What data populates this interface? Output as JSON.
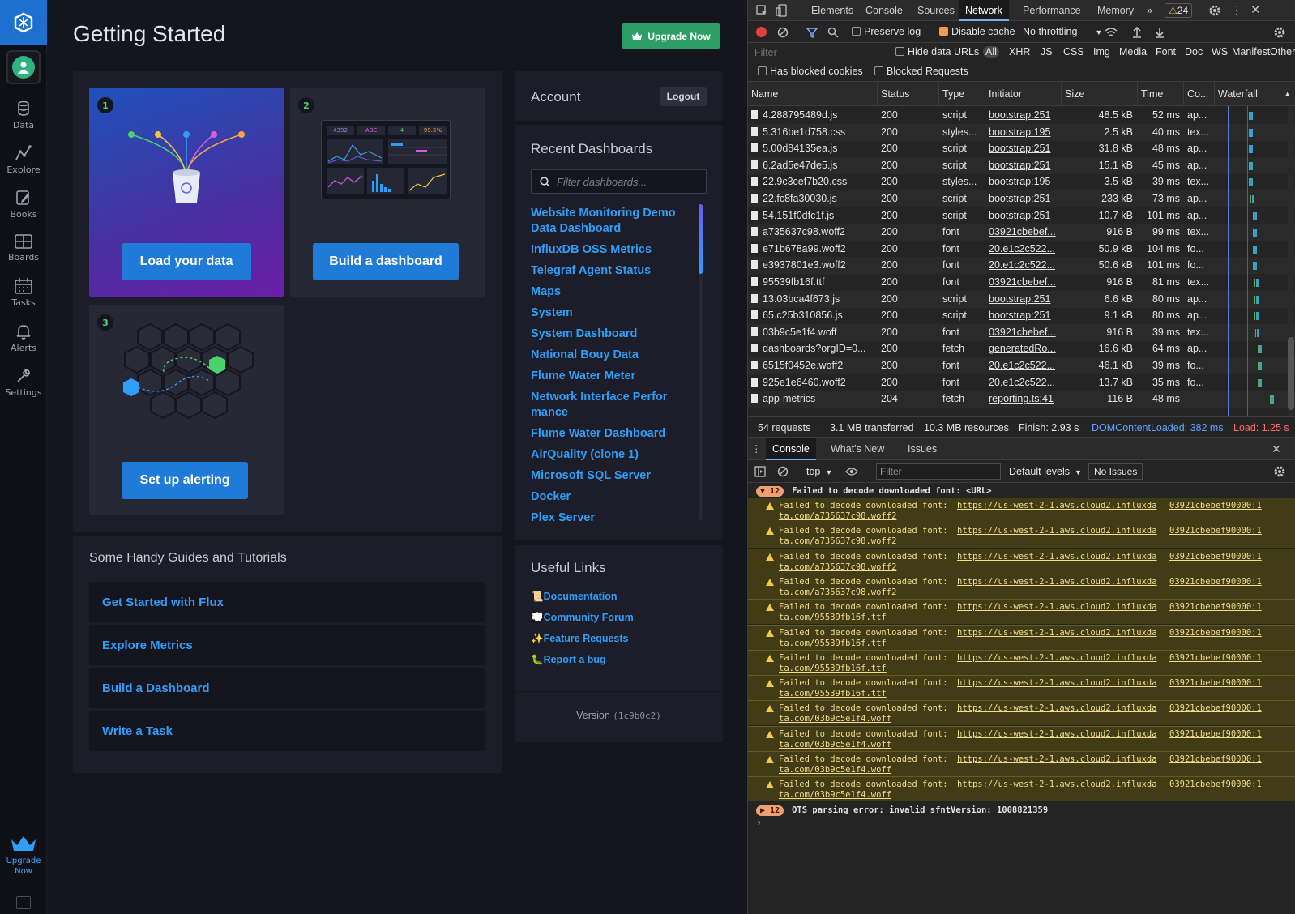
{
  "app": {
    "nav": {
      "items": [
        {
          "label": "Data",
          "icon": "database-icon"
        },
        {
          "label": "Explore",
          "icon": "graph-icon"
        },
        {
          "label": "Books",
          "icon": "notebook-icon"
        },
        {
          "label": "Boards",
          "icon": "dashboard-grid-icon"
        },
        {
          "label": "Tasks",
          "icon": "calendar-icon"
        },
        {
          "label": "Alerts",
          "icon": "bell-icon"
        },
        {
          "label": "Settings",
          "icon": "wrench-icon"
        }
      ],
      "upgrade_line1": "Upgrade",
      "upgrade_line2": "Now"
    },
    "page_title": "Getting Started",
    "upgrade_button": "Upgrade Now",
    "cards": [
      {
        "number": "1",
        "button": "Load your data"
      },
      {
        "number": "2",
        "button": "Build a dashboard"
      },
      {
        "number": "3",
        "button": "Set up alerting"
      }
    ],
    "card2_preview_labels": [
      "4392",
      "ABC",
      "4",
      "99.5%"
    ],
    "guides": {
      "title": "Some Handy Guides and Tutorials",
      "items": [
        "Get Started with Flux",
        "Explore Metrics",
        "Build a Dashboard",
        "Write a Task"
      ]
    },
    "account": {
      "title": "Account",
      "logout": "Logout"
    },
    "recent": {
      "title": "Recent Dashboards",
      "filter_placeholder": "Filter dashboards...",
      "items": [
        "Website Monitoring Demo Data Dashboard",
        "InfluxDB OSS Metrics",
        "Telegraf Agent Status",
        "Maps",
        "System",
        "System Dashboard",
        "National Bouy Data",
        "Flume Water Meter",
        "Network Interface Perfor mance",
        "Flume Water Dashboard",
        "AirQuality (clone 1)",
        "Microsoft SQL Server",
        "Docker",
        "Plex Server"
      ]
    },
    "useful_links": {
      "title": "Useful Links",
      "items": [
        {
          "emoji": "📜",
          "label": "Documentation"
        },
        {
          "emoji": "💭",
          "label": "Community Forum"
        },
        {
          "emoji": "✨",
          "label": "Feature Requests"
        },
        {
          "emoji": "🐛",
          "label": "Report a bug"
        }
      ],
      "version_label": "Version",
      "version_code": "(1c9b0c2)"
    }
  },
  "devtools": {
    "tabs": [
      "Elements",
      "Console",
      "Sources",
      "Network",
      "Performance",
      "Memory"
    ],
    "active_tab": "Network",
    "more_tabs": "»",
    "warning_count": "24",
    "toolbar": {
      "preserve_log": "Preserve log",
      "disable_cache": "Disable cache",
      "throttling": "No throttling",
      "filter_placeholder": "Filter",
      "hide_data_urls": "Hide data URLs",
      "types": [
        "All",
        "XHR",
        "JS",
        "CSS",
        "Img",
        "Media",
        "Font",
        "Doc",
        "WS",
        "Manifest",
        "Other"
      ],
      "has_blocked_cookies": "Has blocked cookies",
      "blocked_requests": "Blocked Requests"
    },
    "columns": [
      "Name",
      "Status",
      "Type",
      "Initiator",
      "Size",
      "Time",
      "Co...",
      "Waterfall"
    ],
    "rows": [
      {
        "name": "4.288795489d.js",
        "status": "200",
        "type": "script",
        "initiator": "bootstrap:251",
        "size": "48.5 kB",
        "time": "52 ms",
        "co": "ap..."
      },
      {
        "name": "5.316be1d758.css",
        "status": "200",
        "type": "styles...",
        "initiator": "bootstrap:195",
        "size": "2.5 kB",
        "time": "40 ms",
        "co": "tex..."
      },
      {
        "name": "5.00d84135ea.js",
        "status": "200",
        "type": "script",
        "initiator": "bootstrap:251",
        "size": "31.8 kB",
        "time": "48 ms",
        "co": "ap..."
      },
      {
        "name": "6.2ad5e47de5.js",
        "status": "200",
        "type": "script",
        "initiator": "bootstrap:251",
        "size": "15.1 kB",
        "time": "45 ms",
        "co": "ap..."
      },
      {
        "name": "22.9c3cef7b20.css",
        "status": "200",
        "type": "styles...",
        "initiator": "bootstrap:195",
        "size": "3.5 kB",
        "time": "39 ms",
        "co": "tex..."
      },
      {
        "name": "22.fc8fa30030.js",
        "status": "200",
        "type": "script",
        "initiator": "bootstrap:251",
        "size": "233 kB",
        "time": "73 ms",
        "co": "ap..."
      },
      {
        "name": "54.151f0dfc1f.js",
        "status": "200",
        "type": "script",
        "initiator": "bootstrap:251",
        "size": "10.7 kB",
        "time": "101 ms",
        "co": "ap..."
      },
      {
        "name": "a735637c98.woff2",
        "status": "200",
        "type": "font",
        "initiator": "03921cbebef...",
        "size": "916 B",
        "time": "99 ms",
        "co": "tex..."
      },
      {
        "name": "e71b678a99.woff2",
        "status": "200",
        "type": "font",
        "initiator": "20.e1c2c522...",
        "size": "50.9 kB",
        "time": "104 ms",
        "co": "fo..."
      },
      {
        "name": "e3937801e3.woff2",
        "status": "200",
        "type": "font",
        "initiator": "20.e1c2c522...",
        "size": "50.6 kB",
        "time": "101 ms",
        "co": "fo..."
      },
      {
        "name": "95539fb16f.ttf",
        "status": "200",
        "type": "font",
        "initiator": "03921cbebef...",
        "size": "916 B",
        "time": "81 ms",
        "co": "tex..."
      },
      {
        "name": "13.03bca4f673.js",
        "status": "200",
        "type": "script",
        "initiator": "bootstrap:251",
        "size": "6.6 kB",
        "time": "80 ms",
        "co": "ap..."
      },
      {
        "name": "65.c25b310856.js",
        "status": "200",
        "type": "script",
        "initiator": "bootstrap:251",
        "size": "9.1 kB",
        "time": "80 ms",
        "co": "ap..."
      },
      {
        "name": "03b9c5e1f4.woff",
        "status": "200",
        "type": "font",
        "initiator": "03921cbebef...",
        "size": "916 B",
        "time": "39 ms",
        "co": "tex..."
      },
      {
        "name": "dashboards?orgID=0...",
        "status": "200",
        "type": "fetch",
        "initiator": "generatedRo...",
        "size": "16.6 kB",
        "time": "64 ms",
        "co": "ap..."
      },
      {
        "name": "6515f0452e.woff2",
        "status": "200",
        "type": "font",
        "initiator": "20.e1c2c522...",
        "size": "46.1 kB",
        "time": "39 ms",
        "co": "fo..."
      },
      {
        "name": "925e1e6460.woff2",
        "status": "200",
        "type": "font",
        "initiator": "20.e1c2c522...",
        "size": "13.7 kB",
        "time": "35 ms",
        "co": "fo..."
      },
      {
        "name": "app-metrics",
        "status": "204",
        "type": "fetch",
        "initiator": "reporting.ts:41",
        "size": "116 B",
        "time": "48 ms",
        "co": ""
      }
    ],
    "summary": {
      "requests": "54 requests",
      "transferred": "3.1 MB transferred",
      "resources": "10.3 MB resources",
      "finish": "Finish: 2.93 s",
      "dcl": "DOMContentLoaded: 382 ms",
      "load": "Load: 1.25 s"
    },
    "drawer_tabs": [
      "Console",
      "What's New",
      "Issues"
    ],
    "console_bar": {
      "context": "top",
      "filter_placeholder": "Filter",
      "levels": "Default levels",
      "issues": "No Issues"
    },
    "console": {
      "group1_count": "12",
      "group1_text": "Failed to decode downloaded font: <URL>",
      "warnings": [
        {
          "msg": "Failed to decode downloaded font:",
          "url": "https://us-west-2-1.aws.cloud2.influxda",
          "url2": "ta.com/a735637c98.woff2",
          "src": "03921cbebef90000:1"
        },
        {
          "msg": "Failed to decode downloaded font:",
          "url": "https://us-west-2-1.aws.cloud2.influxda",
          "url2": "ta.com/a735637c98.woff2",
          "src": "03921cbebef90000:1"
        },
        {
          "msg": "Failed to decode downloaded font:",
          "url": "https://us-west-2-1.aws.cloud2.influxda",
          "url2": "ta.com/a735637c98.woff2",
          "src": "03921cbebef90000:1"
        },
        {
          "msg": "Failed to decode downloaded font:",
          "url": "https://us-west-2-1.aws.cloud2.influxda",
          "url2": "ta.com/a735637c98.woff2",
          "src": "03921cbebef90000:1"
        },
        {
          "msg": "Failed to decode downloaded font:",
          "url": "https://us-west-2-1.aws.cloud2.influxda",
          "url2": "ta.com/95539fb16f.ttf",
          "src": "03921cbebef90000:1"
        },
        {
          "msg": "Failed to decode downloaded font:",
          "url": "https://us-west-2-1.aws.cloud2.influxda",
          "url2": "ta.com/95539fb16f.ttf",
          "src": "03921cbebef90000:1"
        },
        {
          "msg": "Failed to decode downloaded font:",
          "url": "https://us-west-2-1.aws.cloud2.influxda",
          "url2": "ta.com/95539fb16f.ttf",
          "src": "03921cbebef90000:1"
        },
        {
          "msg": "Failed to decode downloaded font:",
          "url": "https://us-west-2-1.aws.cloud2.influxda",
          "url2": "ta.com/95539fb16f.ttf",
          "src": "03921cbebef90000:1"
        },
        {
          "msg": "Failed to decode downloaded font:",
          "url": "https://us-west-2-1.aws.cloud2.influxda",
          "url2": "ta.com/03b9c5e1f4.woff",
          "src": "03921cbebef90000:1"
        },
        {
          "msg": "Failed to decode downloaded font:",
          "url": "https://us-west-2-1.aws.cloud2.influxda",
          "url2": "ta.com/03b9c5e1f4.woff",
          "src": "03921cbebef90000:1"
        },
        {
          "msg": "Failed to decode downloaded font:",
          "url": "https://us-west-2-1.aws.cloud2.influxda",
          "url2": "ta.com/03b9c5e1f4.woff",
          "src": "03921cbebef90000:1"
        },
        {
          "msg": "Failed to decode downloaded font:",
          "url": "https://us-west-2-1.aws.cloud2.influxda",
          "url2": "ta.com/03b9c5e1f4.woff",
          "src": "03921cbebef90000:1"
        }
      ],
      "group2_count": "12",
      "group2_text": "OTS parsing error: invalid sfntVersion: 1008821359",
      "prompt": "›"
    }
  }
}
